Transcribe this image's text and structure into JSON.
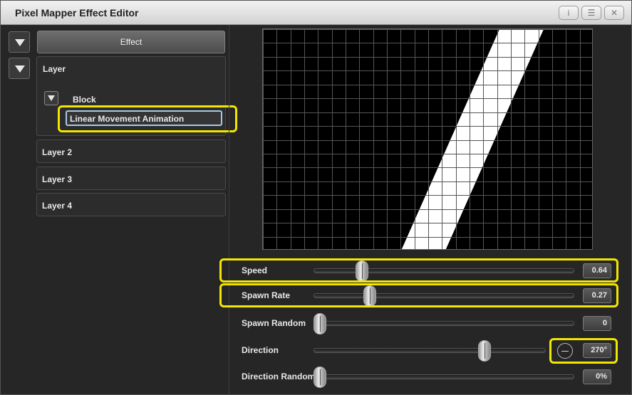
{
  "window": {
    "title": "Pixel Mapper Effect Editor",
    "buttons": {
      "info": "i",
      "menu": "☰",
      "close": "✕"
    }
  },
  "left": {
    "effect_label": "Effect",
    "layer_label": "Layer",
    "block_label": "Block",
    "animation_name": "Linear Movement Animation",
    "layers": [
      "Layer 2",
      "Layer 3",
      "Layer 4"
    ]
  },
  "preview": {
    "cols": 24,
    "rows": 16,
    "band_color": "#ffffff",
    "grid_color": "#555555",
    "background": "#000000"
  },
  "controls": [
    {
      "label": "Speed",
      "value": "0.64",
      "level": 0.17,
      "highlighted": true,
      "icon": null
    },
    {
      "label": "Spawn Rate",
      "value": "0.27",
      "level": 0.2,
      "highlighted": true,
      "icon": null
    },
    {
      "label": "Spawn Random",
      "value": "0",
      "level": 0.0,
      "highlighted": false,
      "icon": null
    },
    {
      "label": "Direction",
      "value": "270°",
      "level": 0.75,
      "highlighted": true,
      "icon": "dial-icon"
    },
    {
      "label": "Direction Random",
      "value": "0%",
      "level": 0.0,
      "highlighted": false,
      "icon": null
    }
  ],
  "colors": {
    "highlight": "#f2e600",
    "field_border": "#a8c8e8"
  }
}
